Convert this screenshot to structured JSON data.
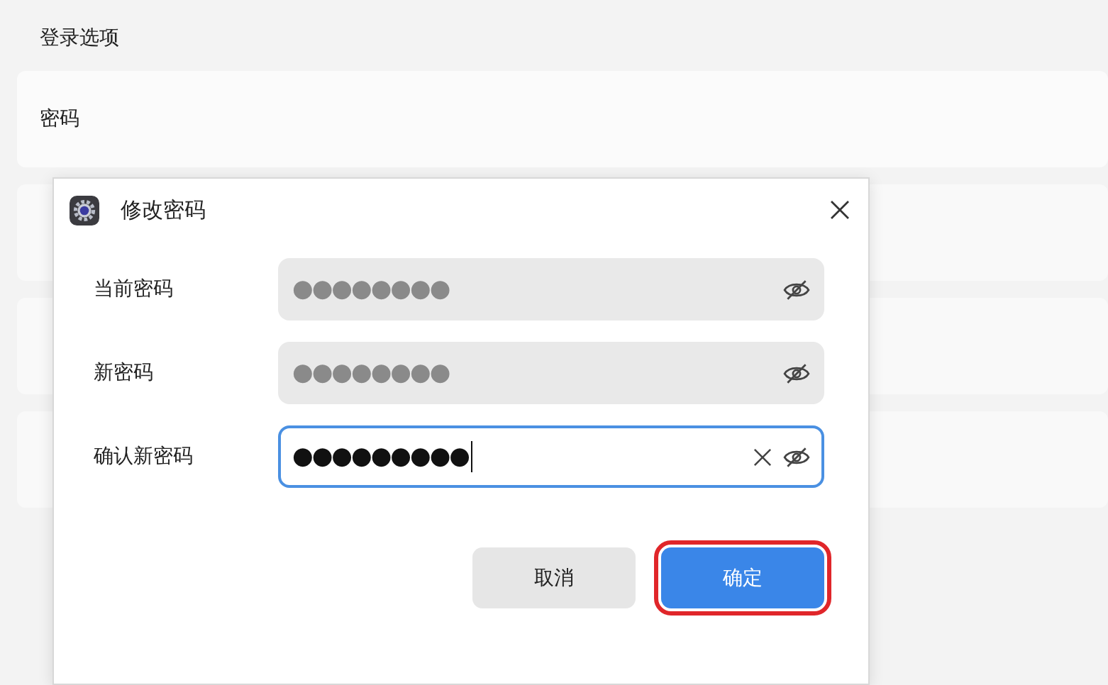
{
  "section_title": "登录选项",
  "cards": [
    {
      "kind": "labeled",
      "label": "密码"
    },
    {
      "kind": "covered"
    },
    {
      "kind": "covered"
    },
    {
      "kind": "covered"
    }
  ],
  "dialog": {
    "title": "修改密码",
    "fields": [
      {
        "label": "当前密码",
        "value": "●●●●●●●●",
        "disabled": true,
        "focused": false
      },
      {
        "label": "新密码",
        "value": "●●●●●●●●",
        "disabled": true,
        "focused": false
      },
      {
        "label": "确认新密码",
        "value": "●●●●●●●●●",
        "disabled": false,
        "focused": true
      }
    ],
    "buttons": [
      {
        "label": "取消",
        "kind": "secondary",
        "highlighted": false
      },
      {
        "label": "确定",
        "kind": "primary",
        "highlighted": true
      }
    ]
  }
}
